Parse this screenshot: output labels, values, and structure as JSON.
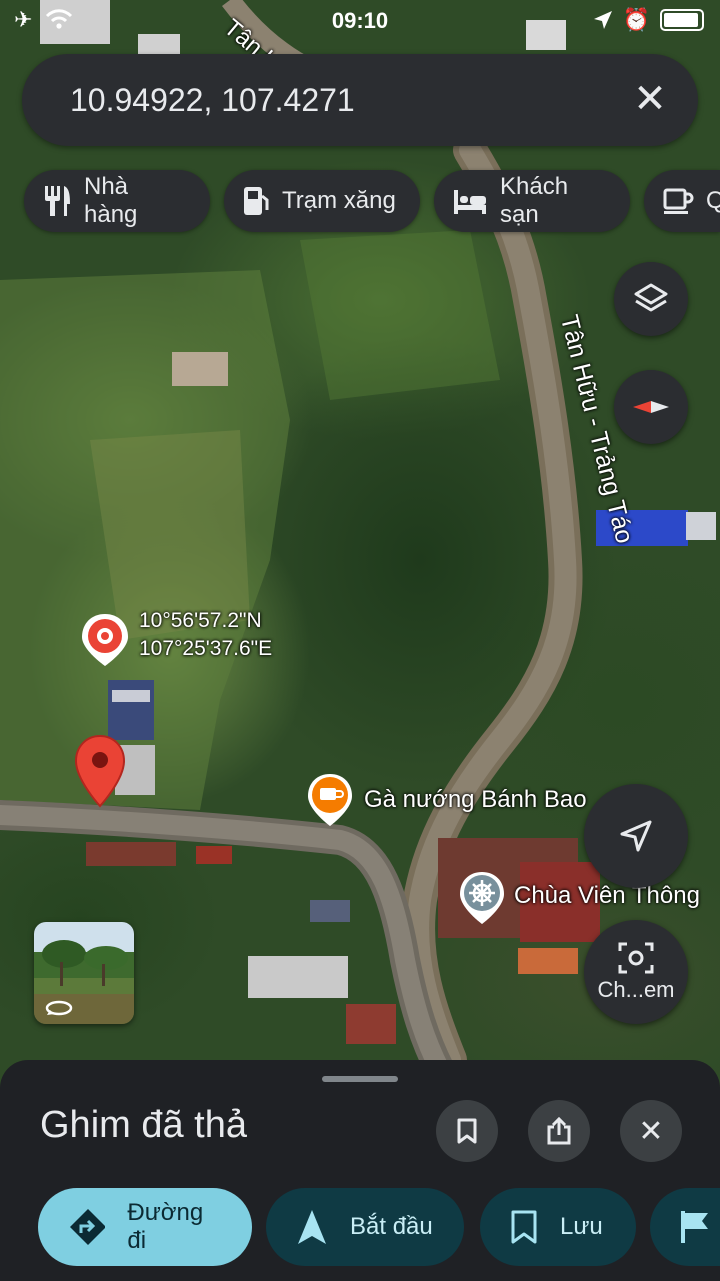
{
  "status_bar": {
    "time": "09:10",
    "left_icons": [
      "airplane-icon",
      "wifi-icon"
    ],
    "right_icons": [
      "location-arrow-icon",
      "alarm-icon",
      "battery-icon"
    ]
  },
  "search": {
    "query": "10.94922, 107.4271",
    "clear_icon": "close-icon"
  },
  "category_chips": [
    {
      "label": "Nhà hàng",
      "icon": "restaurant-icon"
    },
    {
      "label": "Trạm xăng",
      "icon": "gas-station-icon"
    },
    {
      "label": "Khách sạn",
      "icon": "hotel-bed-icon"
    },
    {
      "label": "Q",
      "icon": "coffee-cup-icon"
    }
  ],
  "map": {
    "road_label_top": "Tân Hữu - T",
    "road_label_main": "Tân Hữu - Trảng Táo",
    "dropped_pin_lat": "10°56'57.2\"N",
    "dropped_pin_lng": "107°25'37.6\"E",
    "poi_restaurant": "Gà nướng Bánh Bao",
    "poi_temple": "Chùa Viên Thông",
    "camera_button_label": "Ch...em",
    "accent_pin_color": "#ea4335",
    "accent_poi_color": "#f57c00"
  },
  "sheet": {
    "title": "Ghim đã thả",
    "actions": [
      {
        "label": "Đường đi",
        "icon": "directions-icon"
      },
      {
        "label": "Bắt đầu",
        "icon": "navigation-arrow-icon"
      },
      {
        "label": "Lưu",
        "icon": "bookmark-icon"
      },
      {
        "label": "",
        "icon": "flag-icon"
      }
    ]
  }
}
